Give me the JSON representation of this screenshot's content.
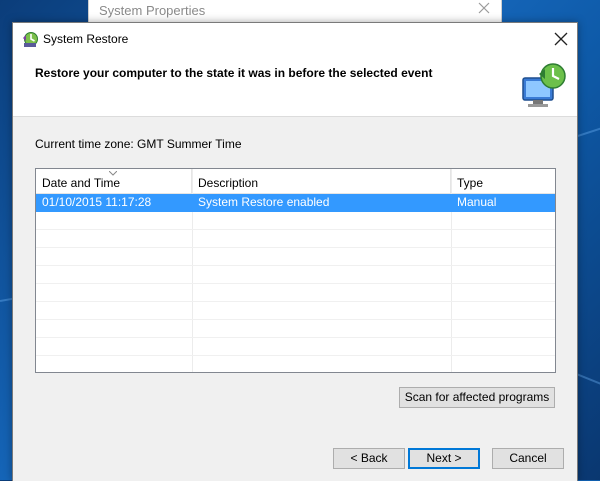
{
  "background_window": {
    "title": "System Properties"
  },
  "dialog": {
    "title": "System Restore",
    "header_text": "Restore your computer to the state it was in before the selected event",
    "timezone_text": "Current time zone: GMT Summer Time",
    "table": {
      "columns": [
        "Date and Time",
        "Description",
        "Type"
      ],
      "rows": [
        {
          "date_time": "01/10/2015 11:17:28",
          "description": "System Restore enabled",
          "type": "Manual",
          "selected": true
        }
      ]
    },
    "buttons": {
      "scan": "Scan for affected programs",
      "back": "< Back",
      "next": "Next >",
      "cancel": "Cancel"
    }
  },
  "colors": {
    "selection": "#3399ff",
    "accent": "#0078d7",
    "desktop": "#1565b8"
  }
}
